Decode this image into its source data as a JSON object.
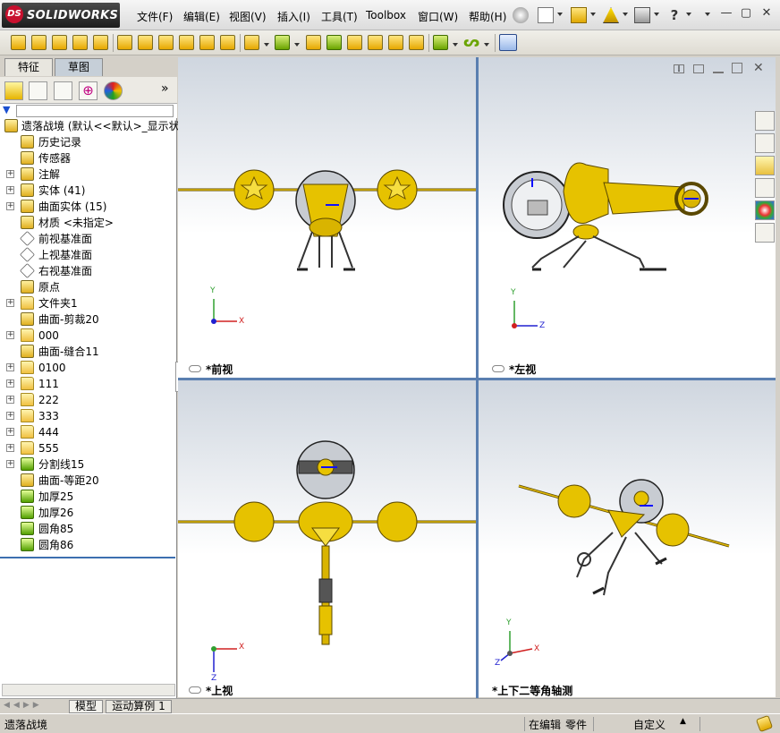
{
  "app": {
    "logo_text": "SOLIDWORKS",
    "logo_mark": "DS"
  },
  "menu": {
    "items": [
      "文件(F)",
      "编辑(E)",
      "视图(V)",
      "插入(I)",
      "工具(T)",
      "Toolbox",
      "窗口(W)",
      "帮助(H)"
    ]
  },
  "panel": {
    "tabs": [
      "特征",
      "草图"
    ],
    "tree": [
      {
        "label": "遗落战境    (默认<<默认>_显示状",
        "icon": "part-icon",
        "expander": false
      },
      {
        "label": "历史记录",
        "icon": "history-icon",
        "expander": false
      },
      {
        "label": "传感器",
        "icon": "sensor-icon",
        "expander": false
      },
      {
        "label": "注解",
        "icon": "annotation-icon",
        "expander": true
      },
      {
        "label": "实体 (41)",
        "icon": "solid-bodies-icon",
        "expander": true
      },
      {
        "label": "曲面实体 (15)",
        "icon": "surface-bodies-icon",
        "expander": true
      },
      {
        "label": "材质 <未指定>",
        "icon": "material-icon",
        "expander": false
      },
      {
        "label": "前视基准面",
        "icon": "plane-icon",
        "expander": false
      },
      {
        "label": "上视基准面",
        "icon": "plane-icon",
        "expander": false
      },
      {
        "label": "右视基准面",
        "icon": "plane-icon",
        "expander": false
      },
      {
        "label": "原点",
        "icon": "origin-icon",
        "expander": false
      },
      {
        "label": "文件夹1",
        "icon": "folder-icon",
        "expander": true
      },
      {
        "label": "曲面-剪裁20",
        "icon": "surface-trim-icon",
        "expander": false
      },
      {
        "label": "000",
        "icon": "folder-icon",
        "expander": true
      },
      {
        "label": "曲面-缝合11",
        "icon": "surface-knit-icon",
        "expander": false
      },
      {
        "label": "0100",
        "icon": "folder-icon",
        "expander": true
      },
      {
        "label": "111",
        "icon": "folder-icon",
        "expander": true
      },
      {
        "label": "222",
        "icon": "folder-icon",
        "expander": true
      },
      {
        "label": "333",
        "icon": "folder-icon",
        "expander": true
      },
      {
        "label": "444",
        "icon": "folder-icon",
        "expander": true
      },
      {
        "label": "555",
        "icon": "folder-icon",
        "expander": true
      },
      {
        "label": "分割线15",
        "icon": "split-line-icon",
        "expander": true
      },
      {
        "label": "曲面-等距20",
        "icon": "surface-offset-icon",
        "expander": false
      },
      {
        "label": "加厚25",
        "icon": "thicken-icon",
        "expander": false
      },
      {
        "label": "加厚26",
        "icon": "thicken-icon",
        "expander": false
      },
      {
        "label": "圆角85",
        "icon": "fillet-icon",
        "expander": false
      },
      {
        "label": "圆角86",
        "icon": "fillet-icon",
        "expander": false
      }
    ]
  },
  "viewports": {
    "front": "*前视",
    "left": "*左视",
    "top": "*上视",
    "iso": "*上下二等角轴测"
  },
  "axes": {
    "x": "X",
    "y": "Y",
    "z": "Z"
  },
  "bottom_tabs": [
    "模型",
    "运动算例 1"
  ],
  "status": {
    "doc_name": "遗落战境",
    "mode": "在编辑",
    "doc_type": "零件",
    "units": "自定义"
  },
  "colors": {
    "accent": "#3d6fb0",
    "model_gold": "#e6c200",
    "logo_red": "#c8102e"
  }
}
